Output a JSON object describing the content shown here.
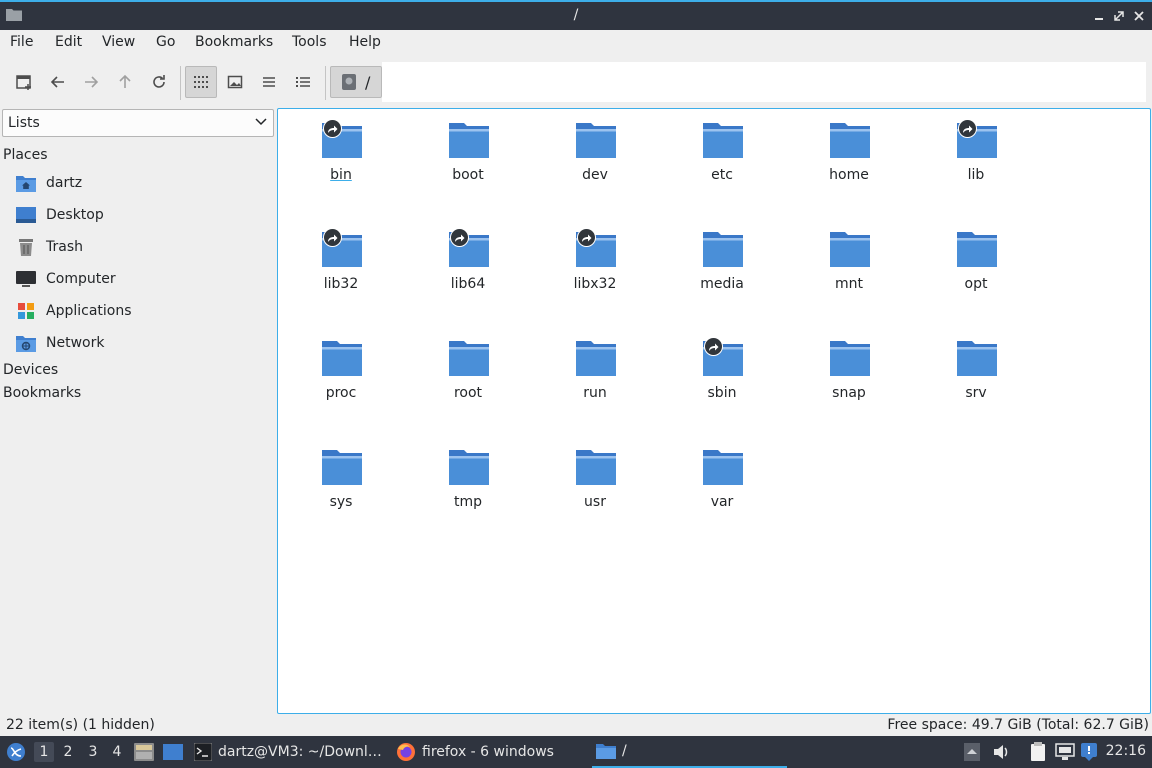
{
  "window": {
    "title": "/"
  },
  "menu": [
    "File",
    "Edit",
    "Go",
    "Bookmarks",
    "Tools",
    "Help",
    "View"
  ],
  "menu_items": {
    "file": "File",
    "edit": "Edit",
    "view": "View",
    "go": "Go",
    "bookmarks": "Bookmarks",
    "tools": "Tools",
    "help": "Help"
  },
  "path": {
    "text": "/"
  },
  "sidepane": {
    "combo": "Lists",
    "places_header": "Places",
    "places": [
      "dartz",
      "Desktop",
      "Trash",
      "Computer",
      "Applications",
      "Network"
    ],
    "devices_header": "Devices",
    "bookmarks_header": "Bookmarks"
  },
  "files": [
    "bin",
    "boot",
    "dev",
    "etc",
    "home",
    "lib",
    "lib32",
    "lib64",
    "libx32",
    "media",
    "mnt",
    "opt",
    "proc",
    "root",
    "run",
    "sbin",
    "snap",
    "srv",
    "sys",
    "tmp",
    "usr",
    "var"
  ],
  "symlinks": [
    "bin",
    "lib",
    "lib32",
    "lib64",
    "libx32",
    "sbin"
  ],
  "status": {
    "left": "22 item(s) (1 hidden)",
    "right": "Free space: 49.7 GiB (Total: 62.7 GiB)"
  },
  "taskbar": {
    "desktops": [
      "1",
      "2",
      "3",
      "4"
    ],
    "tasks": {
      "terminal": "dartz@VM3: ~/Downl…",
      "firefox": "firefox - 6 windows",
      "filemanager": "/"
    },
    "clock": "22:16"
  },
  "colors": {
    "accent": "#3daee9",
    "folder": "#4a8fd8",
    "panel": "#2f343f"
  }
}
